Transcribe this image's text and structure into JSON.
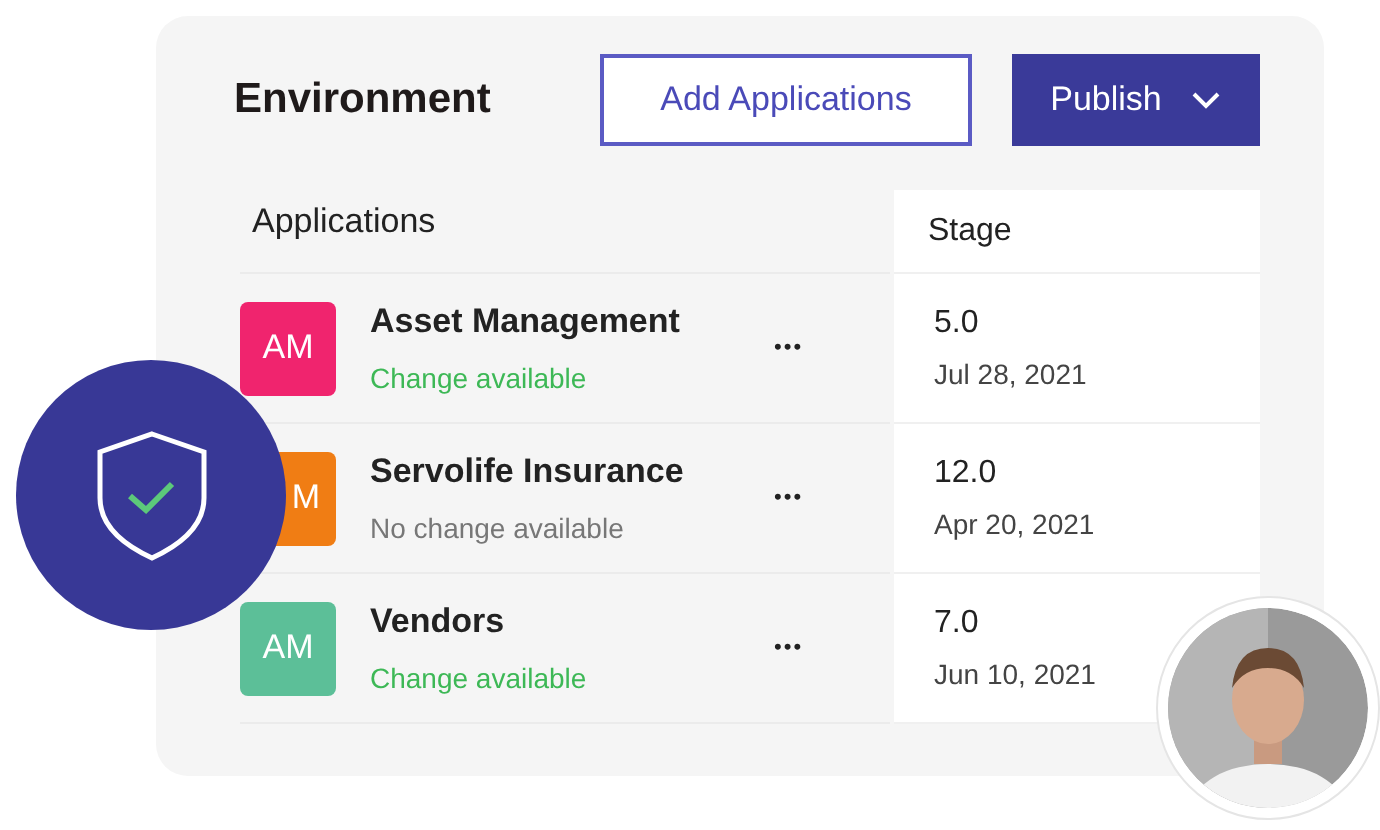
{
  "title": "Environment",
  "buttons": [
    {
      "label": "Add Applications",
      "kind": "outline"
    },
    {
      "label": "Publish",
      "kind": "dropdown"
    }
  ],
  "table": {
    "columns": [
      "Applications",
      "Stage"
    ],
    "rows": [
      {
        "initials": "AM",
        "color": "#f0246e",
        "name": "Asset Management",
        "status": "Change available",
        "available": true,
        "more": "•••",
        "version": "5.0",
        "date": "Jul 28, 2021"
      },
      {
        "initials": "M",
        "covered": true,
        "color": "#f07d14",
        "name": "Servolife Insurance",
        "status": "No change available",
        "available": false,
        "more": "•••",
        "version": "12.0",
        "date": "Apr 20, 2021"
      },
      {
        "initials": "AM",
        "color": "#5cbf98",
        "name": "Vendors",
        "status": "Change available",
        "available": true,
        "more": "•••",
        "version": "7.0",
        "date": "Jun 10, 2021"
      }
    ]
  }
}
